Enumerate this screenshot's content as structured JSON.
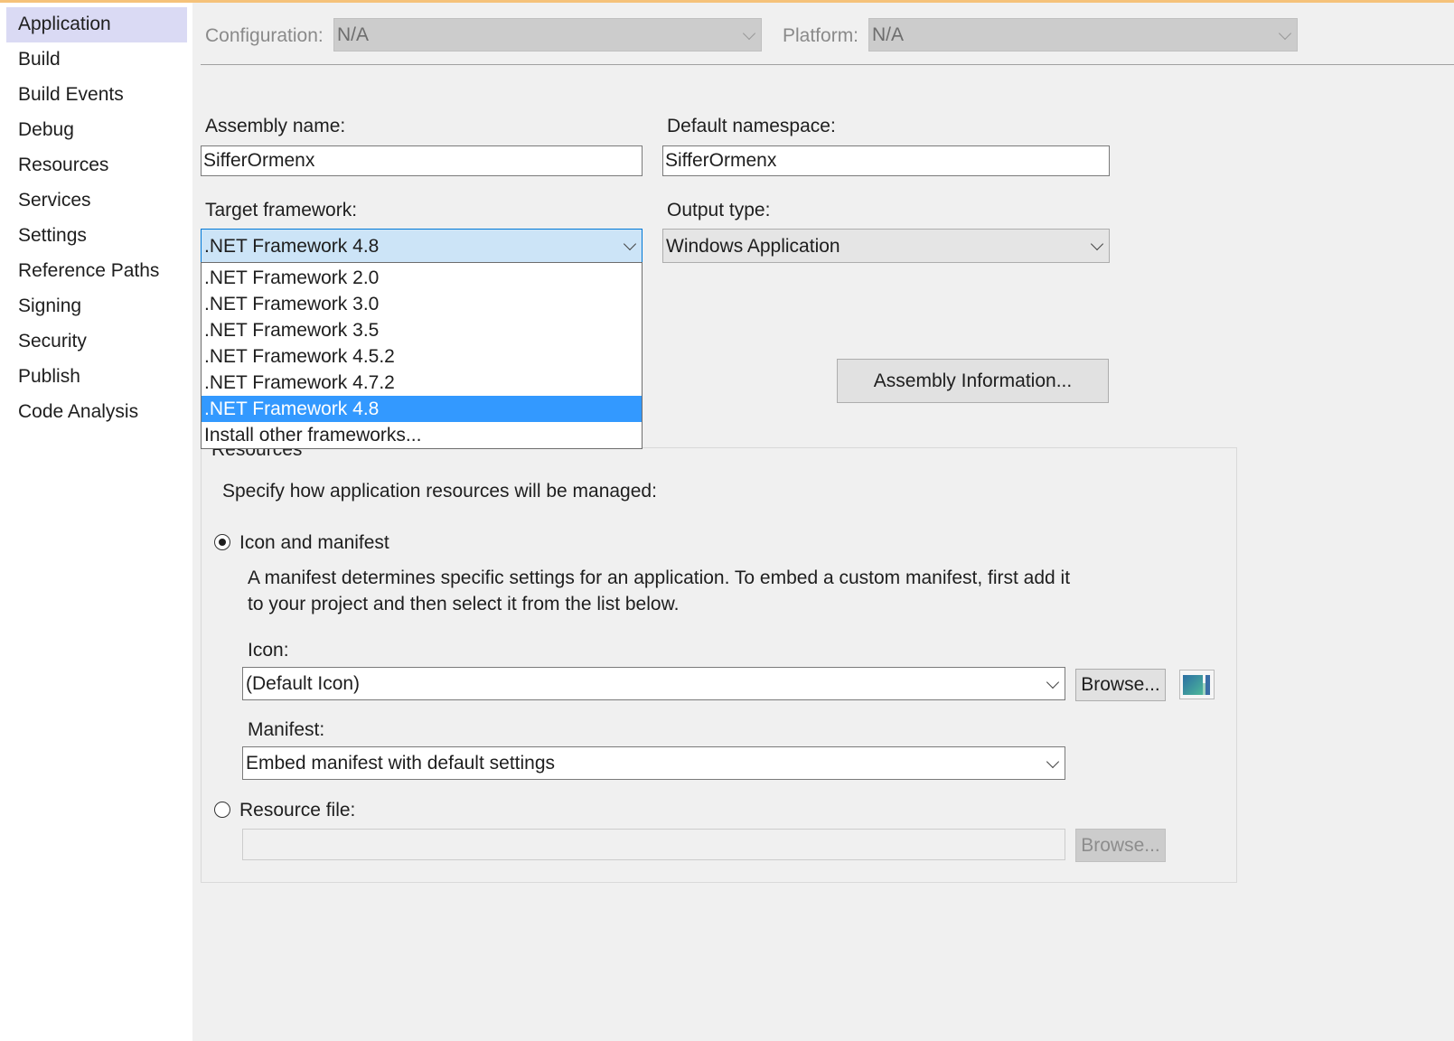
{
  "sidebar": {
    "items": [
      {
        "label": "Application",
        "active": true
      },
      {
        "label": "Build"
      },
      {
        "label": "Build Events"
      },
      {
        "label": "Debug"
      },
      {
        "label": "Resources"
      },
      {
        "label": "Services"
      },
      {
        "label": "Settings"
      },
      {
        "label": "Reference Paths"
      },
      {
        "label": "Signing"
      },
      {
        "label": "Security"
      },
      {
        "label": "Publish"
      },
      {
        "label": "Code Analysis"
      }
    ]
  },
  "toolbar": {
    "configuration_label": "Configuration:",
    "configuration_value": "N/A",
    "platform_label": "Platform:",
    "platform_value": "N/A"
  },
  "assembly_name": {
    "label": "Assembly name:",
    "value": "SifferOrmenx"
  },
  "default_namespace": {
    "label": "Default namespace:",
    "value": "SifferOrmenx"
  },
  "target_framework": {
    "label": "Target framework:",
    "value": ".NET Framework 4.8",
    "options": [
      ".NET Framework 2.0",
      ".NET Framework 3.0",
      ".NET Framework 3.5",
      ".NET Framework 4.5.2",
      ".NET Framework 4.7.2",
      ".NET Framework 4.8",
      "Install other frameworks..."
    ],
    "selected_index": 5
  },
  "output_type": {
    "label": "Output type:",
    "value": "Windows Application"
  },
  "assembly_info_button": "Assembly Information...",
  "resources": {
    "group_label": "Resources",
    "description": "Specify how application resources will be managed:",
    "icon_manifest_option": "Icon and manifest",
    "manifest_help_line1": "A manifest determines specific settings for an application. To embed a custom manifest, first add it",
    "manifest_help_line2": "to your project and then select it from the list below.",
    "icon_label": "Icon:",
    "icon_value": "(Default Icon)",
    "browse_label": "Browse...",
    "manifest_label": "Manifest:",
    "manifest_value": "Embed manifest with default settings",
    "resource_file_option": "Resource file:",
    "resource_file_value": "",
    "resource_browse_label": "Browse..."
  },
  "colors": {
    "accent_selection": "#3399ff",
    "sidebar_active": "#dadaf4",
    "focused_combo": "#cce4f7"
  }
}
